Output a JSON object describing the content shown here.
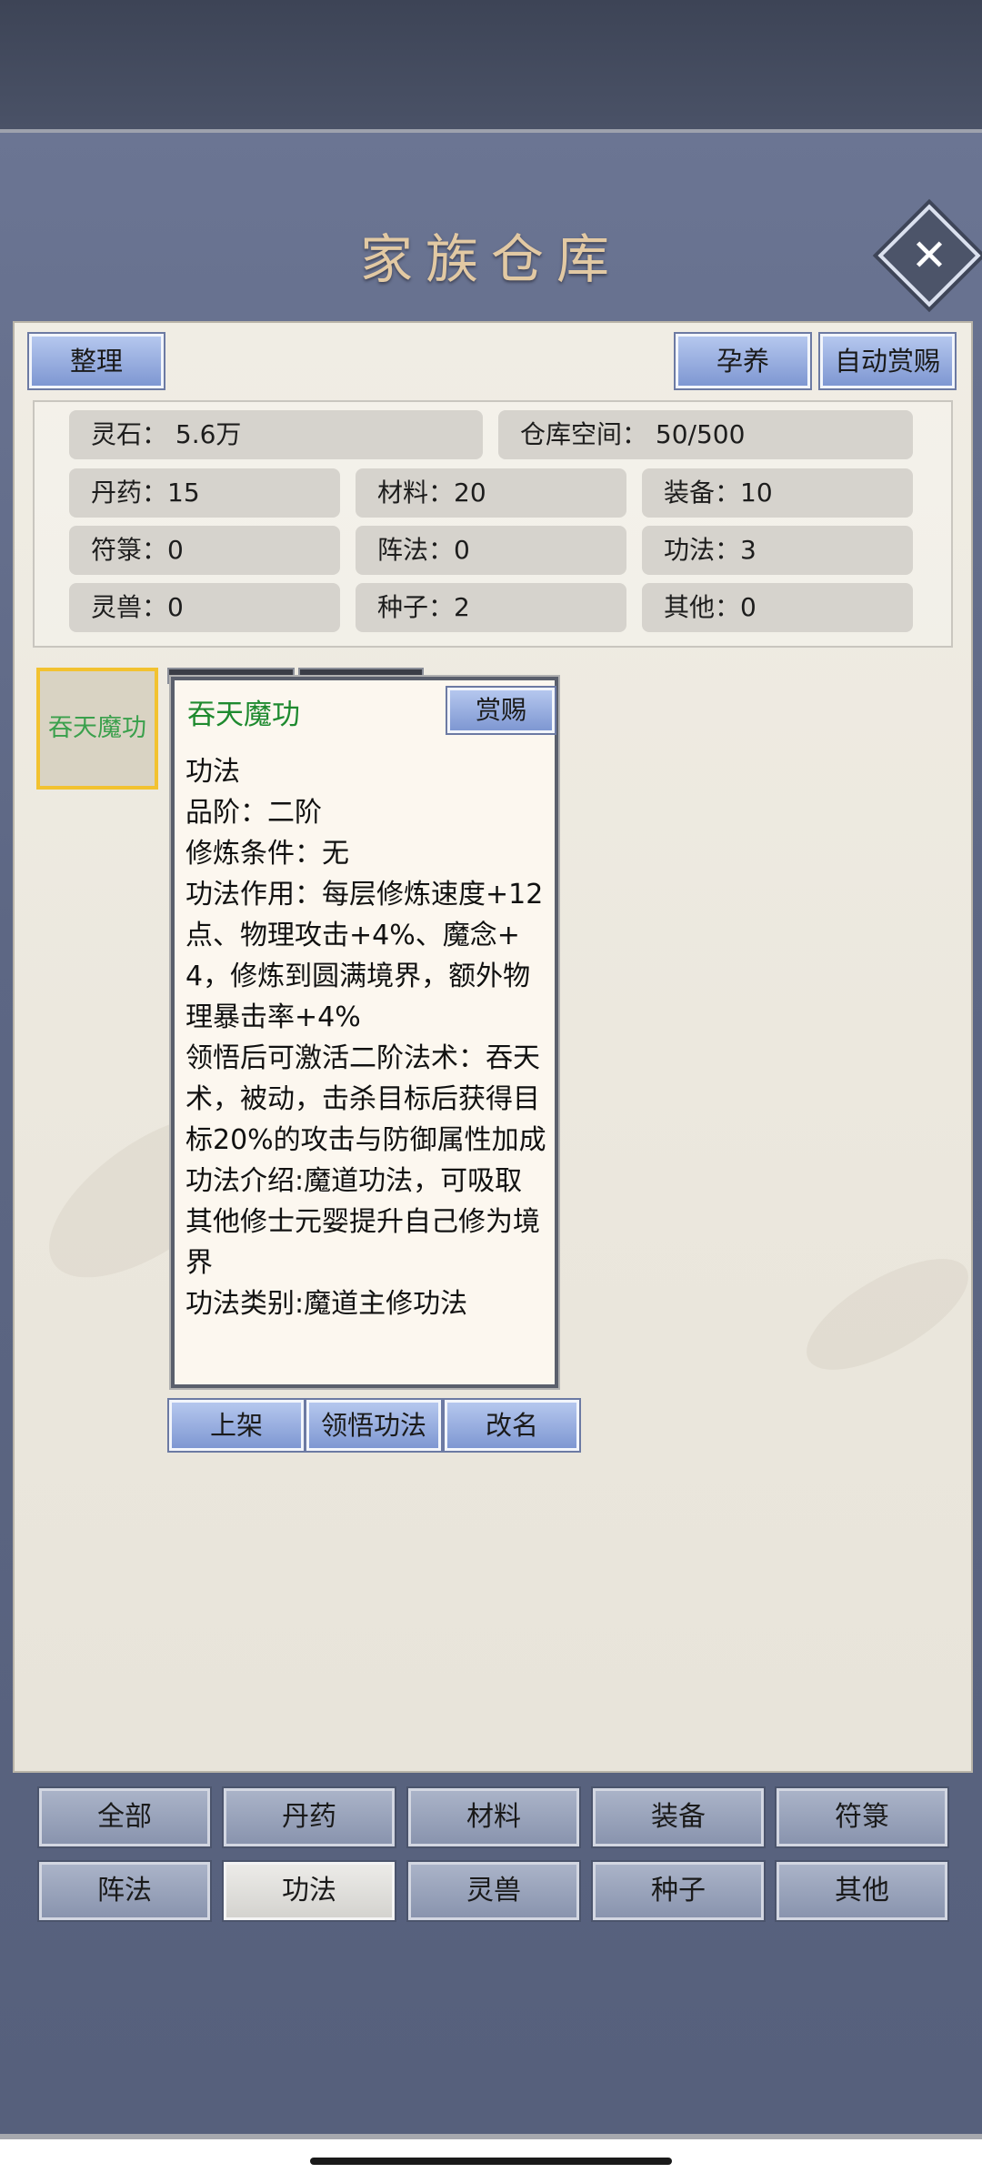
{
  "header": {
    "title": "家族仓库",
    "close_icon": "close-icon"
  },
  "toolbar": {
    "sort_label": "整理",
    "nurture_label": "孕养",
    "auto_reward_label": "自动赏赐"
  },
  "stats": {
    "spirit_stone": "灵石：  5.6万",
    "storage": "仓库空间：   50/500",
    "pills": "丹药：15",
    "materials": "材料：20",
    "equipment": "装备：10",
    "talismans": "符箓：0",
    "formations": "阵法：0",
    "techniques": "功法：3",
    "beasts": "灵兽：0",
    "seeds": "种子：2",
    "others": "其他：0"
  },
  "item": {
    "name": "吞天魔功"
  },
  "tooltip": {
    "title": "吞天魔功",
    "reward_label": "赏赐",
    "lines": [
      "功法",
      "品阶：二阶",
      "修炼条件：无",
      "功法作用：每层修炼速度+12点、物理攻击+4%、魔念+4，修炼到圆满境界，额外物理暴击率+4%",
      "领悟后可激活二阶法术：吞天术，被动，击杀目标后获得目标20%的攻击与防御属性加成",
      "功法介绍:魔道功法，可吸取其他修士元婴提升自己修为境界",
      "功法类别:魔道主修功法"
    ]
  },
  "actions": {
    "shelve_label": "上架",
    "comprehend_label": "领悟功法",
    "rename_label": "改名"
  },
  "categories": [
    "全部",
    "丹药",
    "材料",
    "装备",
    "符箓",
    "阵法",
    "功法",
    "灵兽",
    "种子",
    "其他"
  ],
  "active_category": "功法"
}
